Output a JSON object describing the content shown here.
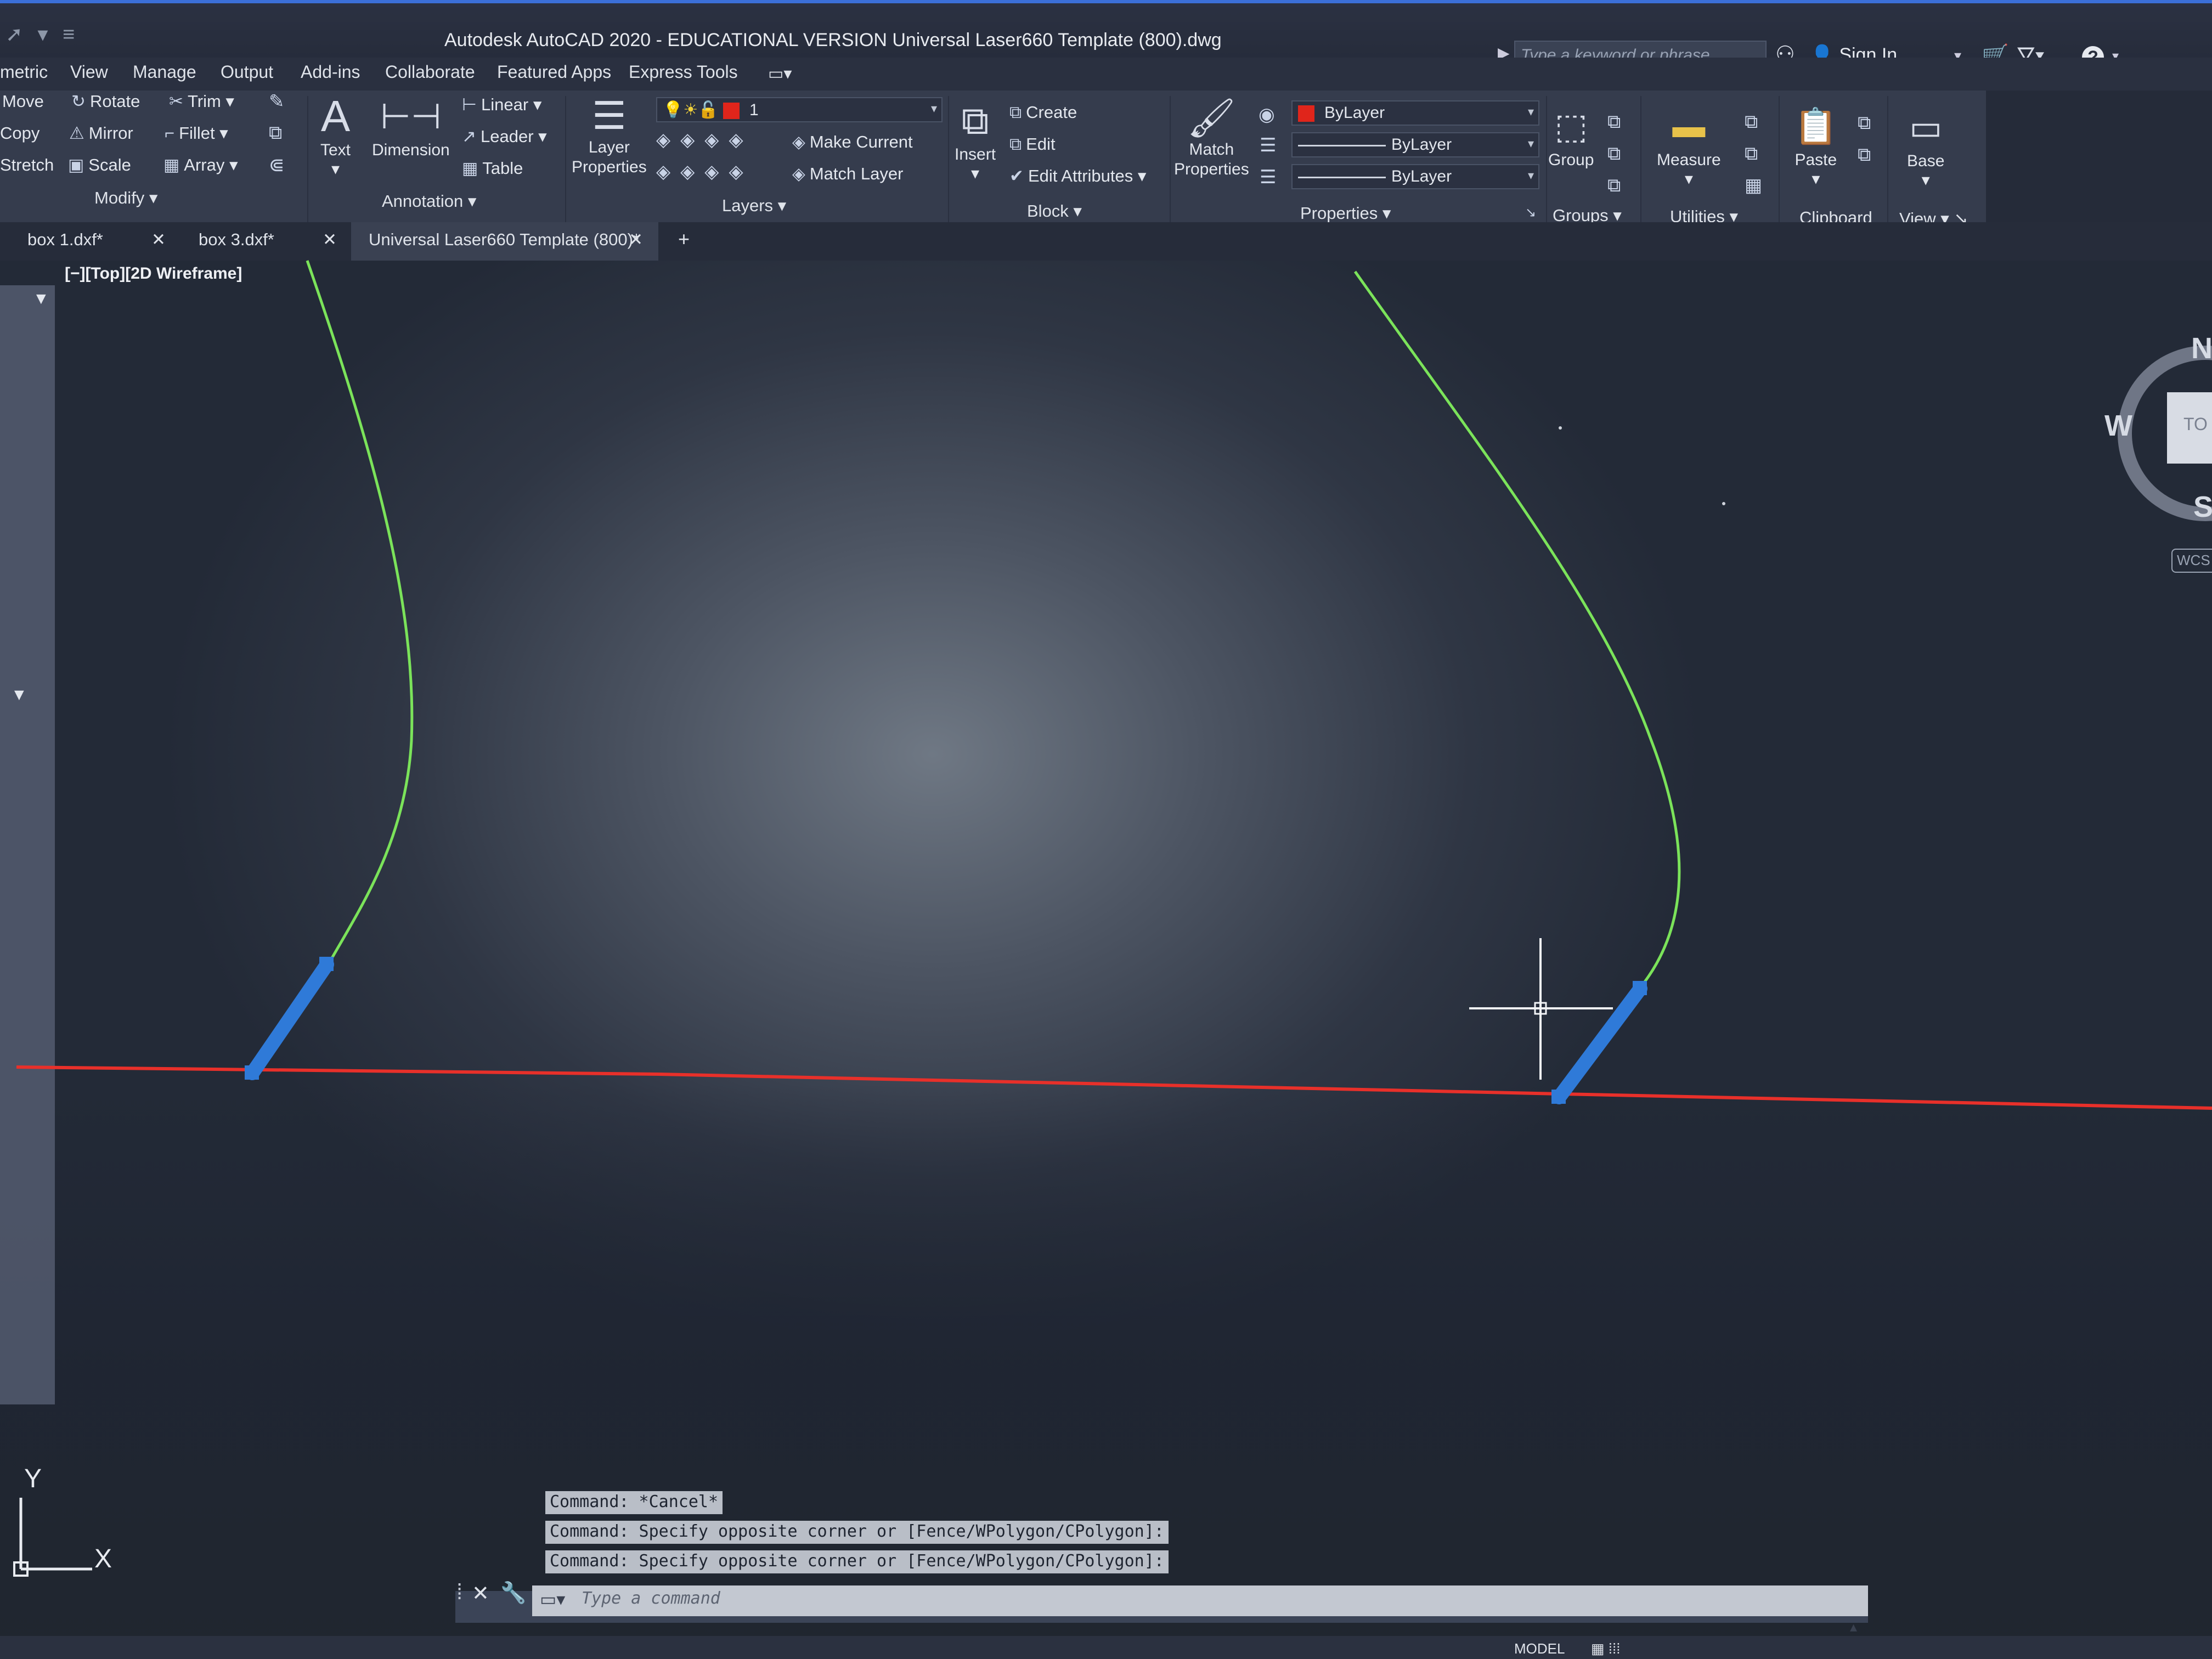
{
  "window": {
    "title": "Autodesk AutoCAD 2020 - EDUCATIONAL VERSION    Universal Laser660 Template (800).dwg",
    "search_placeholder": "Type a keyword or phrase",
    "sign_in_label": "Sign In",
    "help_label": "?"
  },
  "menu_tabs": [
    "metric",
    "View",
    "Manage",
    "Output",
    "Add-ins",
    "Collaborate",
    "Featured Apps",
    "Express Tools"
  ],
  "ribbon": {
    "modify": {
      "title": "Modify",
      "items": [
        "Move",
        "Rotate",
        "Trim",
        "Copy",
        "Mirror",
        "Fillet",
        "Stretch",
        "Scale",
        "Array"
      ]
    },
    "annotation": {
      "title": "Annotation",
      "text_label": "Text",
      "dimension_label": "Dimension",
      "linear_label": "Linear",
      "leader_label": "Leader",
      "table_label": "Table"
    },
    "layers": {
      "title": "Layers",
      "layer_properties_label": "Layer\nProperties",
      "current_layer": "1",
      "make_current_label": "Make Current",
      "match_layer_label": "Match Layer"
    },
    "block": {
      "title": "Block",
      "insert_label": "Insert",
      "create_label": "Create",
      "edit_label": "Edit",
      "edit_attributes_label": "Edit Attributes"
    },
    "properties": {
      "title": "Properties",
      "match_properties_label": "Match\nProperties",
      "color_value": "ByLayer",
      "linetype_value": "ByLayer",
      "lineweight_value": "ByLayer"
    },
    "groups": {
      "title": "Groups",
      "group_label": "Group"
    },
    "utilities": {
      "title": "Utilities",
      "measure_label": "Measure"
    },
    "clipboard": {
      "title": "Clipboard",
      "paste_label": "Paste"
    },
    "view": {
      "title": "View",
      "base_label": "Base"
    }
  },
  "doc_tabs": [
    {
      "label": "box 1.dxf*",
      "active": false
    },
    {
      "label": "box 3.dxf*",
      "active": false
    },
    {
      "label": "Universal Laser660 Template (800)*",
      "active": true
    }
  ],
  "viewport": {
    "label": "[−][Top][2D Wireframe]"
  },
  "viewcube": {
    "north": "N",
    "west": "W",
    "south": "S",
    "face": "TO",
    "wcs": "WCS"
  },
  "ucs": {
    "x": "X",
    "y": "Y"
  },
  "command_line": {
    "history": [
      "Command: *Cancel*",
      "Command: Specify opposite corner or [Fence/WPolygon/CPolygon]:",
      "Command: Specify opposite corner or [Fence/WPolygon/CPolygon]:"
    ],
    "placeholder": "Type a command"
  },
  "status_bar": {
    "model_label": "MODEL"
  },
  "colors": {
    "curve": "#7be35a",
    "baseline": "#e8302a",
    "selection": "#2f7ad8",
    "accent": "#3b6fd8"
  }
}
